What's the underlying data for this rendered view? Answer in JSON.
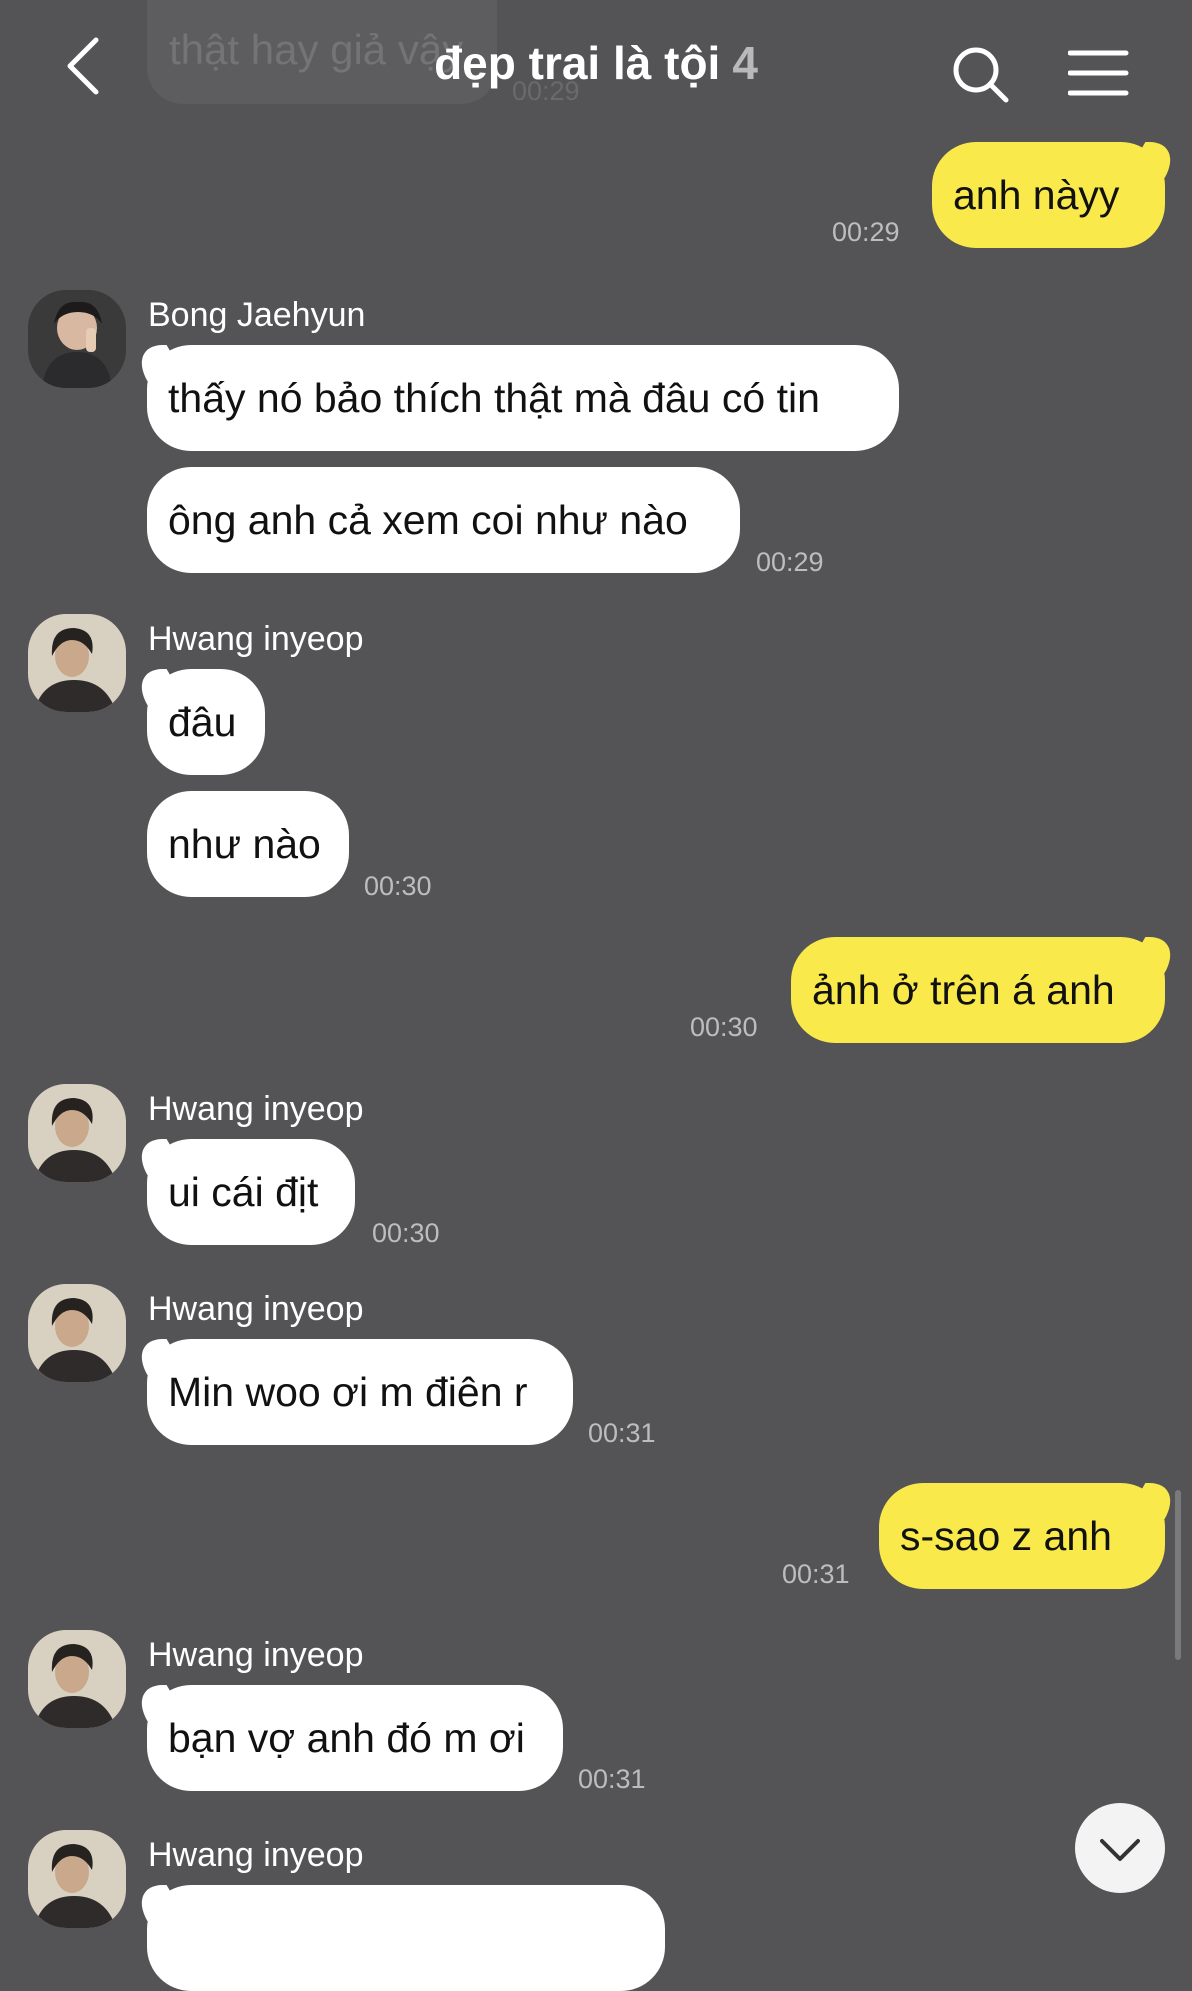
{
  "header": {
    "ghost_message_text": "thật hay giả vậy",
    "ghost_message_time": "00:29",
    "title": "đẹp trai là tội",
    "member_count": "4",
    "back_icon": "chevron-left-icon",
    "search_icon": "search-icon",
    "menu_icon": "menu-icon"
  },
  "messages": [
    {
      "direction": "out",
      "text": "anh nàyy",
      "time": "00:29"
    },
    {
      "direction": "in",
      "sender": "Bong Jaehyun",
      "text": "thấy nó bảo thích thật mà đâu có tin"
    },
    {
      "direction": "in",
      "sender": "Bong Jaehyun",
      "text": "ông anh cả xem coi như nào",
      "time": "00:29"
    },
    {
      "direction": "in",
      "sender": "Hwang inyeop",
      "text": "đâu"
    },
    {
      "direction": "in",
      "sender": "Hwang inyeop",
      "text": "như nào",
      "time": "00:30"
    },
    {
      "direction": "out",
      "text": "ảnh ở trên á anh",
      "time": "00:30"
    },
    {
      "direction": "in",
      "sender": "Hwang inyeop",
      "text": "ui cái địt",
      "time": "00:30"
    },
    {
      "direction": "in",
      "sender": "Hwang inyeop",
      "text": "Min woo ơi m điên r",
      "time": "00:31"
    },
    {
      "direction": "out",
      "text": "s-sao z anh",
      "time": "00:31"
    },
    {
      "direction": "in",
      "sender": "Hwang inyeop",
      "text": "bạn vợ anh đó m ơi",
      "time": "00:31"
    },
    {
      "direction": "in",
      "sender": "Hwang inyeop",
      "text": ""
    }
  ],
  "scroll_down_icon": "chevron-down-icon",
  "colors": {
    "background": "#545355",
    "incoming_bubble": "#ffffff",
    "outgoing_bubble": "#f9e94b",
    "timestamp": "#bdbcbe"
  }
}
